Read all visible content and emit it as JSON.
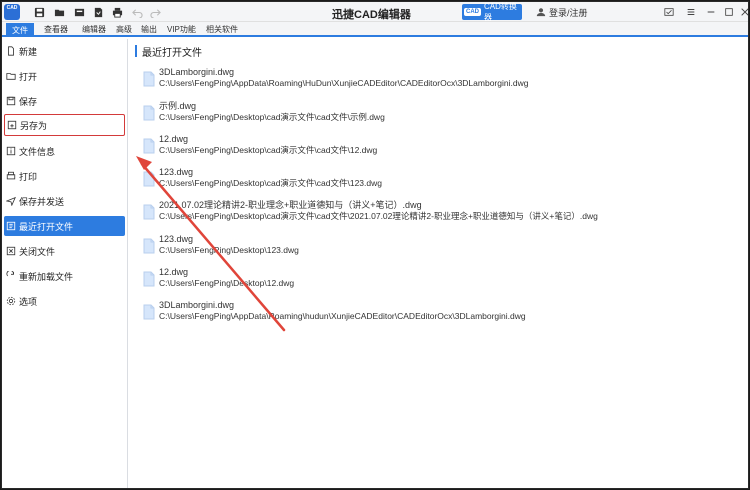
{
  "app": {
    "logo_text": "CAD",
    "title": "迅捷CAD编辑器",
    "convert_badge": "CAD",
    "convert_label": "CAD转换器",
    "login_label": "登录/注册"
  },
  "menu": {
    "items": [
      "文件",
      "查看器",
      "编辑器",
      "高级",
      "输出",
      "VIP功能",
      "相关软件"
    ]
  },
  "sidebar": {
    "items": [
      {
        "label": "新建",
        "icon": "new-file-icon"
      },
      {
        "label": "打开",
        "icon": "open-folder-icon"
      },
      {
        "label": "保存",
        "icon": "save-icon"
      },
      {
        "label": "另存为",
        "icon": "save-as-icon"
      },
      {
        "label": "文件信息",
        "icon": "file-info-icon"
      },
      {
        "label": "打印",
        "icon": "print-icon"
      },
      {
        "label": "保存并发送",
        "icon": "send-icon"
      },
      {
        "label": "最近打开文件",
        "icon": "recent-files-icon"
      },
      {
        "label": "关闭文件",
        "icon": "close-file-icon"
      },
      {
        "label": "重新加载文件",
        "icon": "reload-file-icon"
      },
      {
        "label": "选项",
        "icon": "options-icon"
      }
    ],
    "active_index": 7,
    "highlighted_index": 3
  },
  "main": {
    "section_title": "最近打开文件",
    "files": [
      {
        "name": "3DLamborgini.dwg",
        "path": "C:\\Users\\FengPing\\AppData\\Roaming\\HuDun\\XunjieCADEditor\\CADEditorOcx\\3DLamborgini.dwg"
      },
      {
        "name": "示例.dwg",
        "path": "C:\\Users\\FengPing\\Desktop\\cad演示文件\\cad文件\\示例.dwg"
      },
      {
        "name": "12.dwg",
        "path": "C:\\Users\\FengPing\\Desktop\\cad演示文件\\cad文件\\12.dwg"
      },
      {
        "name": "123.dwg",
        "path": "C:\\Users\\FengPing\\Desktop\\cad演示文件\\cad文件\\123.dwg"
      },
      {
        "name": "2021.07.02理论精讲2-职业理念+职业道德知与（讲义+笔记）.dwg",
        "path": "C:\\Users\\FengPing\\Desktop\\cad演示文件\\cad文件\\2021.07.02理论精讲2-职业理念+职业道德知与（讲义+笔记）.dwg"
      },
      {
        "name": "123.dwg",
        "path": "C:\\Users\\FengPing\\Desktop\\123.dwg"
      },
      {
        "name": "12.dwg",
        "path": "C:\\Users\\FengPing\\Desktop\\12.dwg"
      },
      {
        "name": "3DLamborgini.dwg",
        "path": "C:\\Users\\FengPing\\AppData\\Roaming\\hudun\\XunjieCADEditor\\CADEditorOcx\\3DLamborgini.dwg"
      }
    ]
  },
  "colors": {
    "accent": "#2d7ce0",
    "highlight_outline": "#d33a3a",
    "arrow": "#e0453a"
  }
}
